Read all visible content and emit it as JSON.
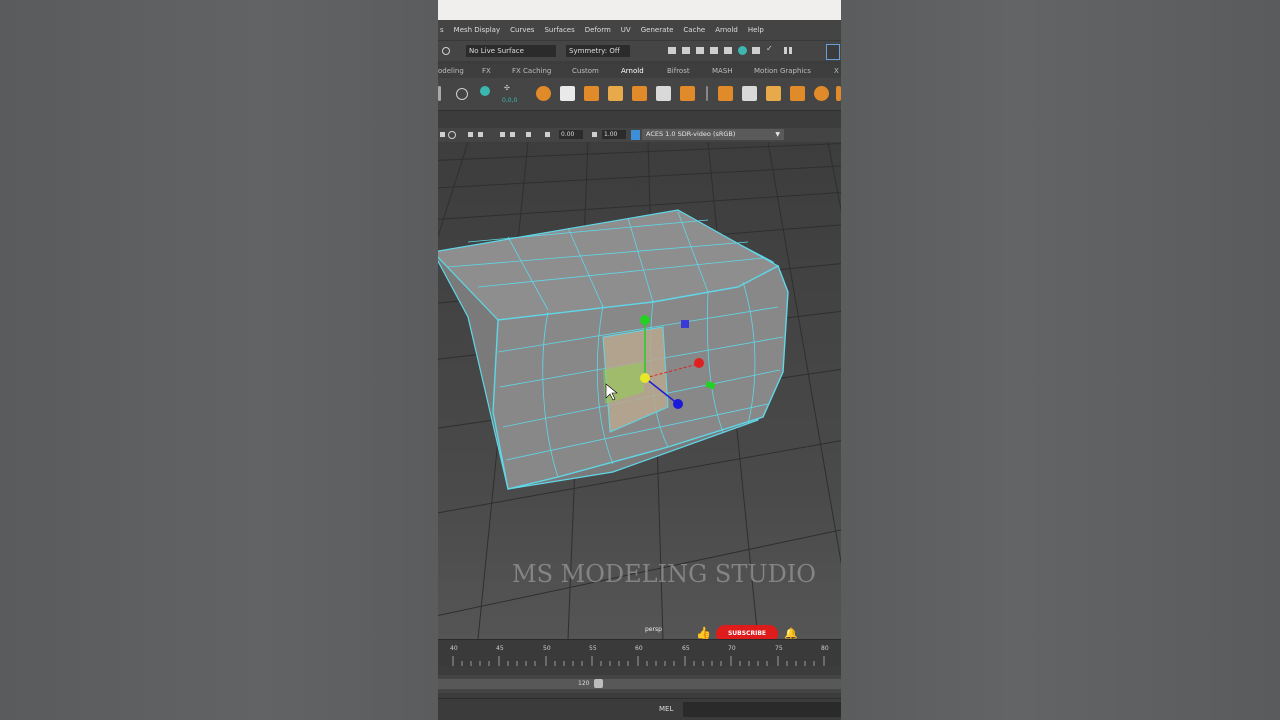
{
  "menubar": {
    "items": [
      "s",
      "Mesh Display",
      "Curves",
      "Surfaces",
      "Deform",
      "UV",
      "Generate",
      "Cache",
      "Arnold",
      "Help"
    ]
  },
  "status_line": {
    "live_surface": "No Live Surface",
    "symmetry": "Symmetry: Off"
  },
  "shelf_tabs": {
    "items": [
      "odeling",
      "FX",
      "FX Caching",
      "Custom",
      "Arnold",
      "Bifrost",
      "MASH",
      "Motion Graphics",
      "X"
    ],
    "active": "Arnold"
  },
  "shelf": {
    "numeric_label": "0,0,0"
  },
  "panel_toolbar": {
    "exposure": "0.00",
    "gamma": "1.00",
    "color_space": "ACES 1.0 SDR-video (sRGB)"
  },
  "viewport": {
    "camera_label": "persp",
    "watermark": "MS MODELING STUDIO"
  },
  "overlay": {
    "subscribe_label": "SUBSCRIBE"
  },
  "timeline": {
    "ticks": [
      "40",
      "45",
      "50",
      "55",
      "60",
      "65",
      "70",
      "75",
      "80"
    ]
  },
  "range_slider": {
    "end_value": "120"
  },
  "command_line": {
    "language": "MEL"
  },
  "colors": {
    "wireframe": "#5fd7e8",
    "gizmo_x": "#e02020",
    "gizmo_y": "#24d024",
    "gizmo_z": "#1a1ad8",
    "gizmo_center": "#e8e82a",
    "subscribe": "#e01b1b"
  }
}
